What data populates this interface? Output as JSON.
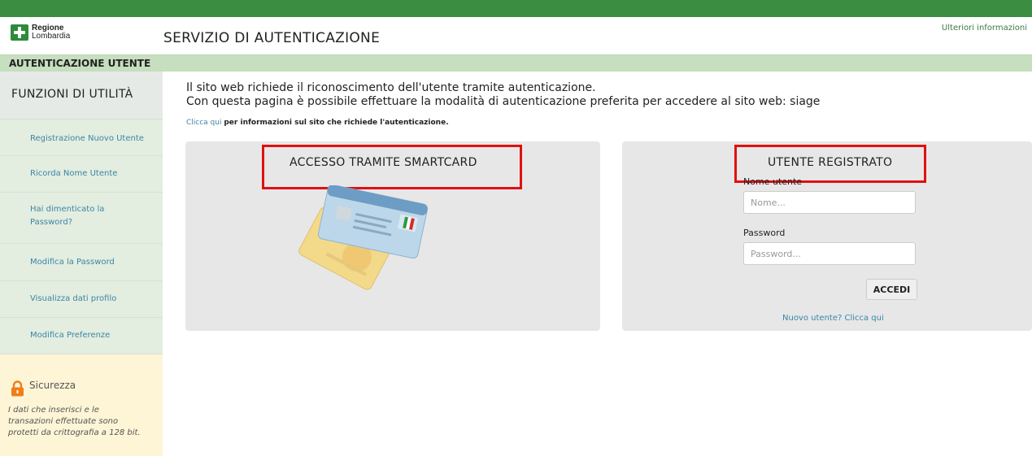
{
  "header": {
    "logo_line1": "Regione",
    "logo_line2": "Lombardia",
    "title": "SERVIZIO DI AUTENTICAZIONE",
    "more_info": "Ulteriori informazioni",
    "section_title": "AUTENTICAZIONE UTENTE"
  },
  "sidebar": {
    "heading": "FUNZIONI DI UTILITÀ",
    "items": [
      {
        "label": "Registrazione Nuovo Utente"
      },
      {
        "label": "Ricorda Nome Utente"
      },
      {
        "label": "Hai dimenticato la"
      },
      {
        "label": "Password?"
      },
      {
        "label": "Modifica la Password"
      },
      {
        "label": "Visualizza dati profilo"
      },
      {
        "label": "Modifica Preferenze"
      }
    ],
    "security": {
      "title": "Sicurezza",
      "text": "I dati che inserisci e le transazioni effettuate sono protetti da crittografia a 128 bit."
    }
  },
  "main": {
    "intro1": "Il sito web richiede il riconoscimento dell'utente tramite autenticazione.",
    "intro2": "Con questa pagina è possibile effettuare la modalità di autenticazione preferita per accedere al sito web: siage",
    "info_link": "Clicca qui",
    "info_text": "per informazioni sul sito che richiede l'autenticazione."
  },
  "smartcard": {
    "title": "ACCESSO TRAMITE SMARTCARD"
  },
  "login": {
    "title": "UTENTE REGISTRATO",
    "username_label": "Nome utente",
    "username_placeholder": "Nome...",
    "password_label": "Password",
    "password_placeholder": "Password...",
    "submit_label": "ACCEDI",
    "new_user_link": "Nuovo utente? Clicca qui"
  },
  "colors": {
    "brand_green": "#3a8d41",
    "highlight_red": "#e01010",
    "link_blue": "#3a86a6"
  }
}
